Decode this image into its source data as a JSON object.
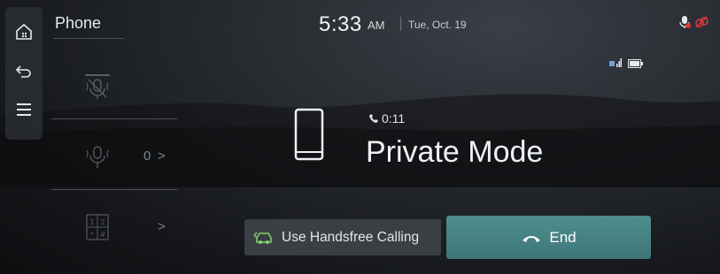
{
  "app": {
    "title": "Phone"
  },
  "status": {
    "time": "5:33",
    "ampm": "AM",
    "date": "Tue, Oct. 19"
  },
  "sidebar": {
    "items": [
      {
        "name": "mute-mic",
        "count": "",
        "chevron": ""
      },
      {
        "name": "mic-volume",
        "count": "0",
        "chevron": ">"
      },
      {
        "name": "keypad",
        "count": "",
        "chevron": ">"
      }
    ]
  },
  "call": {
    "timer": "0:11",
    "name": "Private Mode"
  },
  "buttons": {
    "handsfree": "Use Handsfree Calling",
    "end": "End"
  },
  "colors": {
    "end_button": "#4f8e8f",
    "status_red": "#d83a3a"
  }
}
